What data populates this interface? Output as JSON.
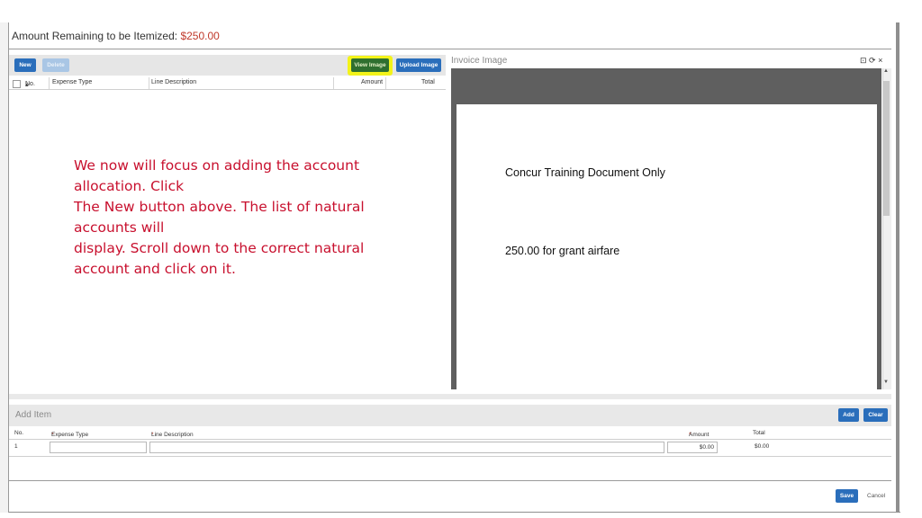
{
  "header": {
    "amount_remaining_label": "Amount Remaining to be Itemized:",
    "amount_remaining_value": "$250.00"
  },
  "toolbar": {
    "new_label": "New",
    "delete_label": "Delete",
    "view_image_label": "View Image",
    "upload_image_label": "Upload Image"
  },
  "itemization_table": {
    "columns": [
      "No.",
      "Expense Type",
      "Line Description",
      "Amount",
      "Total"
    ]
  },
  "instructions": {
    "lines": [
      "We now will focus on adding the account",
      "allocation.  Click",
      "The New button above.  The list of natural",
      "accounts will",
      "display.  Scroll down to the correct natural",
      "account and click on it."
    ]
  },
  "invoice": {
    "title": "Invoice Image",
    "controls": "⊡ ⟳ ×",
    "document_line1": "Concur Training Document Only",
    "document_line2": "250.00 for grant airfare"
  },
  "add_item": {
    "title": "Add Item",
    "add_label": "Add",
    "clear_label": "Clear",
    "columns": {
      "no": "No.",
      "expense_type": "Expense Type",
      "line_description": "Line Description",
      "amount": "Amount",
      "total": "Total"
    },
    "row": {
      "no": "1",
      "expense_type": "",
      "line_description": "",
      "amount": "$0.00",
      "total": "$0.00"
    }
  },
  "footer": {
    "save_label": "Save",
    "cancel_label": "Cancel"
  },
  "colors": {
    "primary_button": "#2a6ebb",
    "highlight": "#f3f31a",
    "instruction_text": "#c8102e",
    "amount_value": "#c0392b"
  }
}
